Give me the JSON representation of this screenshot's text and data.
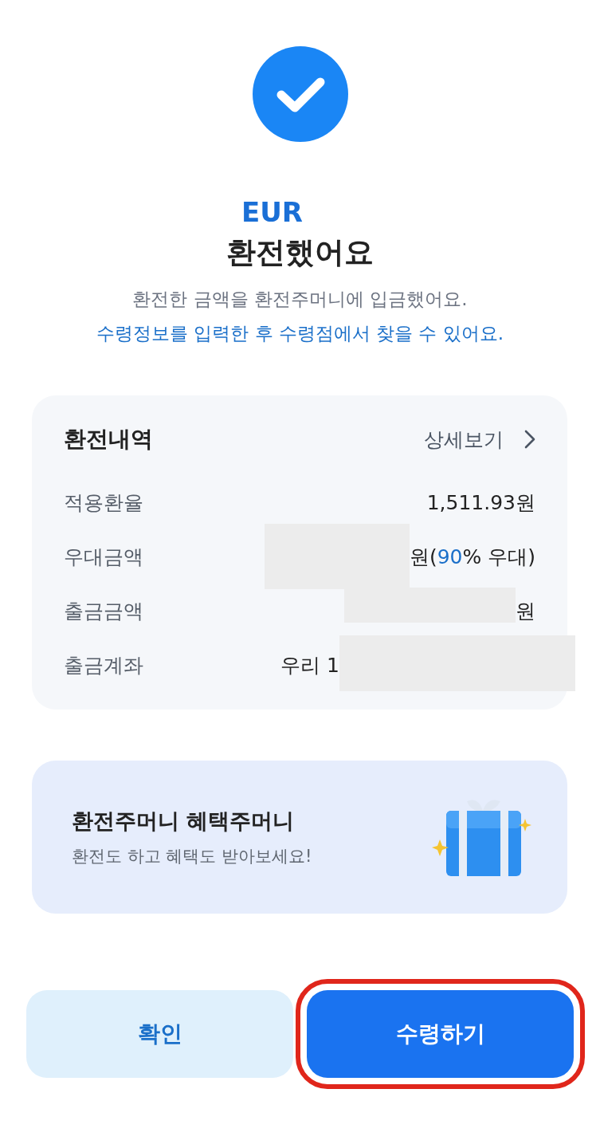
{
  "header": {
    "currency": "EUR",
    "title": "환전했어요",
    "lines": [
      {
        "text": "환전한 금액을 환전주머니에 입금했어요.",
        "kind": "plain"
      },
      {
        "text": "수령정보를 입력한 후 수령점에서 찾을 수 있어요.",
        "kind": "accent"
      }
    ]
  },
  "history": {
    "title": "환전내역",
    "detail_link": "상세보기",
    "rows": [
      {
        "label": "적용환율",
        "value": "1,511.93원"
      },
      {
        "label": "우대금액",
        "value": "원(",
        "highlight": "90",
        "suffix": "% 우대)",
        "redacted_before": true
      },
      {
        "label": "출금금액",
        "value": "원",
        "redacted_before": true
      },
      {
        "label": "출금계좌",
        "value": "우리 1",
        "redacted_after": true
      }
    ]
  },
  "banner": {
    "title": "환전주머니 혜택주머니",
    "subtitle": "환전도 하고 혜택도 받아보세요!"
  },
  "buttons": [
    {
      "label": "확인",
      "kind": "secondary",
      "highlighted": false
    },
    {
      "label": "수령하기",
      "kind": "primary",
      "highlighted": true
    }
  ]
}
